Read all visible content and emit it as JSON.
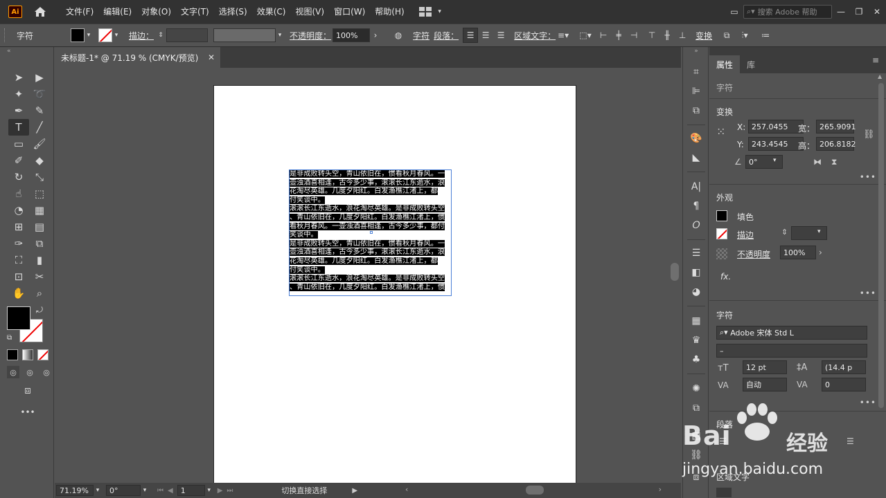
{
  "app": {
    "logo": "Ai",
    "menus": [
      "文件(F)",
      "编辑(E)",
      "对象(O)",
      "文字(T)",
      "选择(S)",
      "效果(C)",
      "视图(V)",
      "窗口(W)",
      "帮助(H)"
    ],
    "search_placeholder": "搜索 Adobe 帮助"
  },
  "control_bar": {
    "mode_label": "字符",
    "stroke_label": "描边：",
    "opacity_label": "不透明度：",
    "opacity_value": "100%",
    "char_label": "字符",
    "para_label": "段落：",
    "area_text_label": "区域文字：",
    "transform_label": "变换"
  },
  "document": {
    "tab_title": "未标题-1* @ 71.19 % (CMYK/预览)",
    "text_lines": [
      {
        "text": "是非成败转头空，青山依旧在，惯看秋月春风。一",
        "hl": true
      },
      {
        "text": "壶浊酒喜相逢，古今多少事，滚滚长江东逝水，浪",
        "hl": true
      },
      {
        "text": "花淘尽英雄。几度夕阳红。白发渔樵江渚上，都",
        "hl": true
      },
      {
        "text": "付笑谈中。",
        "hl": true
      },
      {
        "text": "滚滚长江东逝水，浪花淘尽英雄。是非成败转头空",
        "hl": true
      },
      {
        "text": "、青山依旧在，几度夕阳红。白发渔樵江渚上，惯",
        "hl": true
      },
      {
        "text": "看秋月春风。一壶浊酒喜相逢，古今多少事，都付",
        "hl": true
      },
      {
        "text": "笑谈中。",
        "hl": true
      },
      {
        "text": "是非成败转头空，青山依旧在，惯看秋月春风。一",
        "hl": true
      },
      {
        "text": "壶浊酒喜相逢，古今多少事，滚滚长江东逝水，浪",
        "hl": true
      },
      {
        "text": "花淘尽英雄。几度夕阳红。白发渔樵江渚上，都",
        "hl": true
      },
      {
        "text": "付笑谈中。",
        "hl": true
      },
      {
        "text": "滚滚长江东逝水，浪花淘尽英雄。是非成败转头空",
        "hl": true
      },
      {
        "text": "、青山依旧在，几度夕阳红。白发渔樵江渚上，惯",
        "hl": true
      }
    ]
  },
  "status_bar": {
    "zoom": "71.19%",
    "rotation": "0°",
    "artboard": "1",
    "tool_hint": "切换直接选择"
  },
  "properties": {
    "tab_properties": "属性",
    "tab_library": "库",
    "section_char_top": "字符",
    "transform": {
      "title": "变换",
      "x_label": "X:",
      "x_value": "257.0455",
      "y_label": "Y:",
      "y_value": "243.4545",
      "w_label": "宽：",
      "w_value": "265.9091",
      "h_label": "高：",
      "h_value": "206.8182",
      "angle_value": "0°"
    },
    "appearance": {
      "title": "外观",
      "fill_label": "填色",
      "stroke_label": "描边",
      "opacity_label": "不透明度",
      "opacity_value": "100%",
      "fx_label": "fx."
    },
    "character": {
      "title": "字符",
      "font_family": "Adobe 宋体 Std L",
      "font_style": "–",
      "font_size": "12 pt",
      "leading": "(14.4 p",
      "kerning": "自动",
      "tracking": "0"
    },
    "paragraph_title": "段落",
    "area_text_title": "区域文字"
  },
  "watermark": {
    "brand": "Bai",
    "brand_cn": "经验",
    "url": "jingyan.baidu.com"
  },
  "colors": {
    "menubar_bg": "#323232",
    "panel_bg": "#535353",
    "selection_blue": "#4a7fd7",
    "accent_red": "#e00000"
  }
}
